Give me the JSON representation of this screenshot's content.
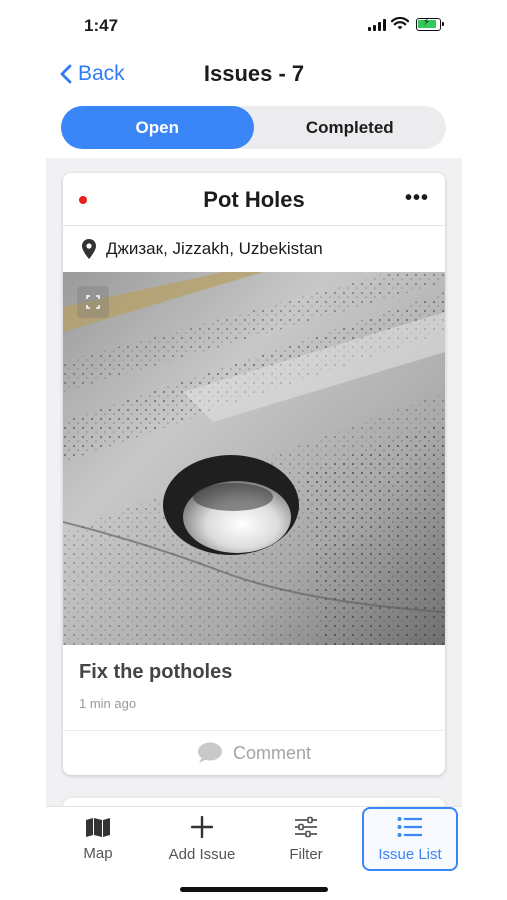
{
  "status_bar": {
    "time": "1:47"
  },
  "nav": {
    "back_label": "Back",
    "title": "Issues - 7"
  },
  "segments": {
    "open": "Open",
    "completed": "Completed",
    "selected": "Open"
  },
  "issue": {
    "title": "Pot Holes",
    "location": "Джизак, Jizzakh, Uzbekistan",
    "description": "Fix the potholes",
    "time_ago": "1 min ago",
    "comment_label": "Comment",
    "status_color": "#e5231b"
  },
  "tabbar": {
    "items": [
      {
        "label": "Map",
        "icon": "map-icon"
      },
      {
        "label": "Add Issue",
        "icon": "plus-icon"
      },
      {
        "label": "Filter",
        "icon": "sliders-icon"
      },
      {
        "label": "Issue List",
        "icon": "list-icon"
      }
    ],
    "active": "Issue List"
  },
  "colors": {
    "accent": "#3b86f6",
    "battery": "#34c759"
  }
}
